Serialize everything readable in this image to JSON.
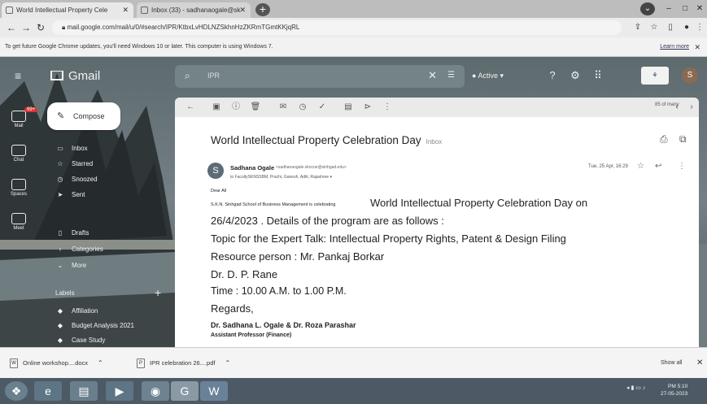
{
  "browser": {
    "tabs": [
      {
        "label": "World Intellectual Property Cele"
      },
      {
        "label": "Inbox (33) - sadhanaogale@sk"
      }
    ],
    "address": "mail.google.com/mail/u/0/#search/IPR/KtbxLvHDLNZSkhnHzZKRmTGmtKKjqRL",
    "infobar": {
      "text": "To get future Google Chrome updates, you'll need Windows 10 or later. This computer is using Windows 7.",
      "learn_more": "Learn more"
    }
  },
  "gmail": {
    "logo": "Gmail",
    "search_query": "IPR",
    "status": "Active",
    "compose": "Compose",
    "rail": {
      "mail_badge": "99+",
      "items": [
        "Mail",
        "Chat",
        "Spaces",
        "Meet"
      ]
    },
    "nav": [
      {
        "label": "Inbox"
      },
      {
        "label": "Starred"
      },
      {
        "label": "Snoozed"
      },
      {
        "label": "Sent"
      },
      {
        "label": "Drafts"
      },
      {
        "label": "Categories"
      },
      {
        "label": "More"
      }
    ],
    "labels_heading": "Labels",
    "label_items": [
      {
        "label": "Affiliation"
      },
      {
        "label": "Budget Analysis 2021"
      },
      {
        "label": "Case Study"
      }
    ],
    "pane": {
      "count": "85 of many",
      "subject": "World Intellectual Property Celebration Day",
      "subject_label": "Inbox",
      "sender_initial": "S",
      "sender_name": "Sadhana Ogale",
      "sender_email": "<sadhanaogale.skncoe@sinhgad.edu>",
      "recipients": "to FacultySKNSSBM, Prachi, Ganesh, Aditi, Rajashree",
      "date": "Tue, 25 Apr, 16:29",
      "body": {
        "dear": "Dear All",
        "intro_small": "S.K.N. Sinhgad School of Business Management is celebrating",
        "intro_big": "World Intellectual Property Celebration Day on",
        "date_line": "26/4/2023 . Details of the program are as follows :",
        "topic": "Topic for the Expert Talk: Intellectual Property Rights, Patent & Design Filing",
        "resource": "Resource person : Mr. Pankaj Borkar",
        "rane": "Dr. D. P. Rane",
        "time": "Time : 10.00 A.M. to 1.00 P.M.",
        "regards": "Regards,",
        "signature": "Dr. Sadhana L. Ogale & Dr. Roza Parashar",
        "role": "Assistant Professor (Finance)"
      }
    }
  },
  "downloads": [
    {
      "name": "Online workshop....docx"
    },
    {
      "name": "IPR celebration 26....pdf"
    }
  ],
  "downloads_show_all": "Show all",
  "taskbar": {
    "tray": "EN",
    "time": "PM 5:10",
    "date": "27-05-2023"
  }
}
